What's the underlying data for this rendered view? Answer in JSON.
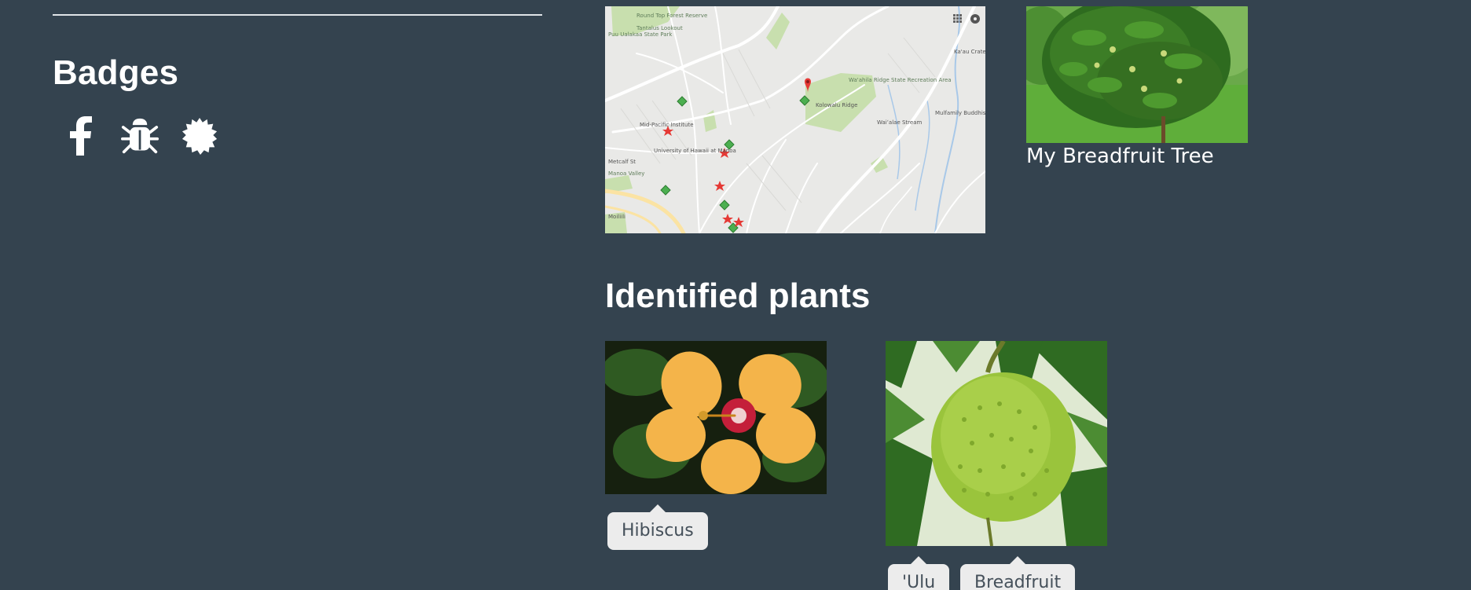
{
  "badges": {
    "heading": "Badges",
    "icons": [
      "facebook-icon",
      "bug-icon",
      "certificate-icon"
    ]
  },
  "map": {
    "labels": [
      "Round Top Forest Reserve",
      "Tantalus Lookout",
      "Puu Ualakaa State Park",
      "Mid-Pacific Institute",
      "University of Hawaii at Manoa",
      "Manoa Valley",
      "Wa'ahila Ridge State Recreation Area",
      "Kolowalu Ridge",
      "Waiʻalae Stream",
      "Mulfamily Buddhist Temple",
      "Ka'au Crater",
      "Moiliili",
      "Metcalf St"
    ]
  },
  "tree": {
    "caption": "My Breadfruit Tree"
  },
  "identified": {
    "heading": "Identified plants",
    "plants": [
      {
        "name": "hibiscus",
        "tags": [
          "Hibiscus"
        ]
      },
      {
        "name": "breadfruit",
        "tags": [
          "'Ulu",
          "Breadfruit"
        ]
      }
    ]
  },
  "colors": {
    "background": "#34434f",
    "text": "#ffffff",
    "tag_bg": "#ececec",
    "tag_text": "#45505a",
    "map_park": "#c8dfae",
    "map_road": "#ffffff"
  }
}
